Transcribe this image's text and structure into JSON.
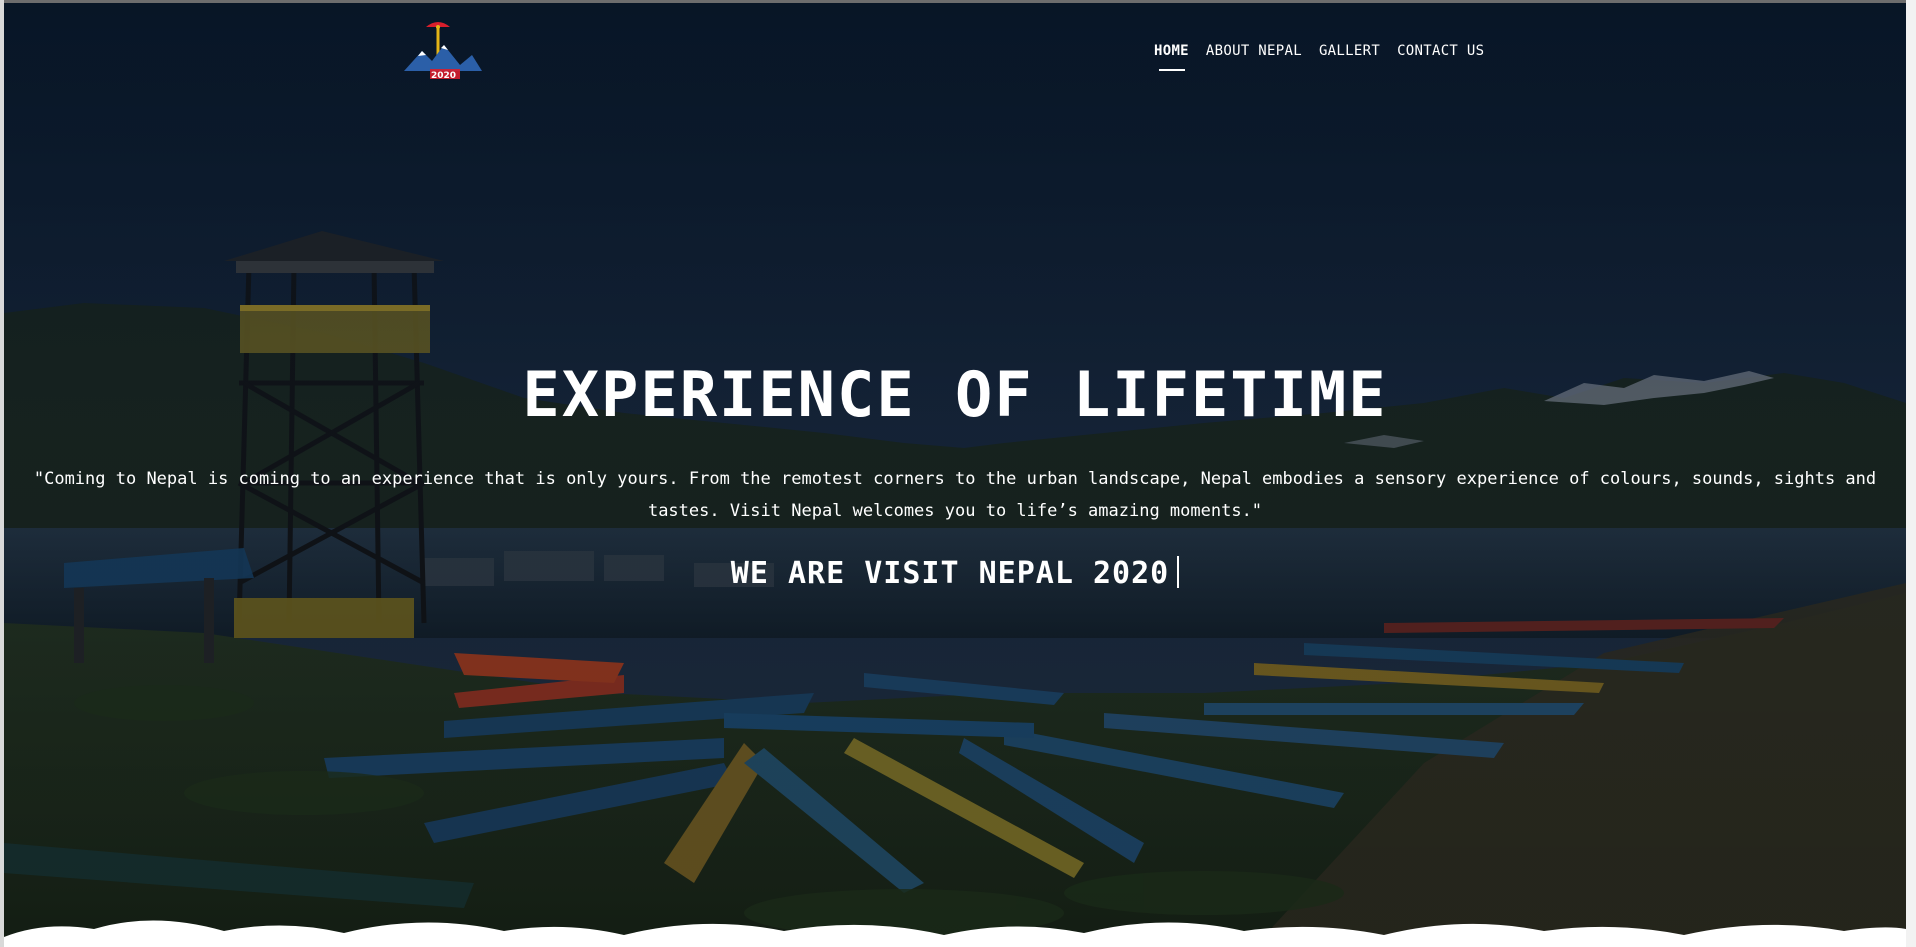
{
  "header": {
    "logo_icon": "visit-nepal-2020-logo",
    "nav": [
      {
        "label": "HOME",
        "active": true
      },
      {
        "label": "ABOUT NEPAL",
        "active": false
      },
      {
        "label": "GALLERT",
        "active": false
      },
      {
        "label": "CONTACT US",
        "active": false
      }
    ]
  },
  "hero": {
    "title": "EXPERIENCE OF LIFETIME",
    "quote": "\"Coming to Nepal is coming to an experience that is only yours. From the remotest corners to the urban landscape, Nepal embodies a sensory experience of colours, sounds, sights and tastes. Visit Nepal welcomes you to life’s amazing moments.\"",
    "tagline": "WE ARE VISIT NEPAL 2020"
  },
  "colors": {
    "text": "#ffffff",
    "sky": "#13253b",
    "lake": "#1d2e3c",
    "clouds": "#ffffff"
  }
}
